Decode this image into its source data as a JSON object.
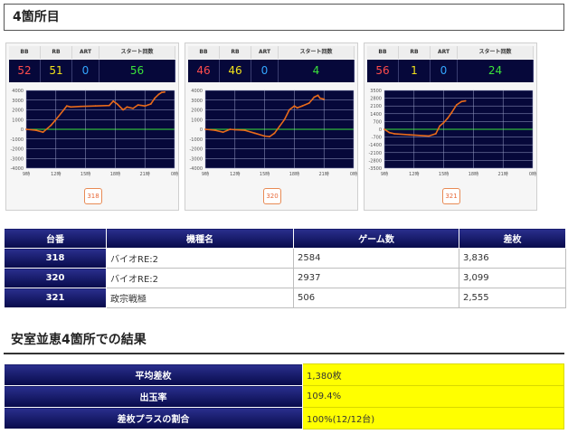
{
  "page_title": "4箇所目",
  "card_headers": [
    "BB",
    "RB",
    "ART",
    "スタート回数"
  ],
  "cards": [
    {
      "bb": "52",
      "rb": "51",
      "art": "0",
      "start": "56",
      "button": "318",
      "y_ticks": [
        "4000",
        "3000",
        "2000",
        "1000",
        "0",
        "-1000",
        "-2000",
        "-3000",
        "-4000"
      ],
      "y_range": [
        -4000,
        4000
      ],
      "x_ticks": [
        "9時",
        "12時",
        "15時",
        "18時",
        "21時",
        "0時"
      ],
      "x_range": [
        9,
        24
      ],
      "series": [
        [
          9,
          0
        ],
        [
          10,
          -100
        ],
        [
          10.7,
          -300
        ],
        [
          11.5,
          400
        ],
        [
          12,
          1000
        ],
        [
          12.8,
          2000
        ],
        [
          13.1,
          2400
        ],
        [
          13.5,
          2300
        ],
        [
          14.5,
          2350
        ],
        [
          16,
          2400
        ],
        [
          17.4,
          2450
        ],
        [
          17.8,
          2900
        ],
        [
          18.2,
          2600
        ],
        [
          18.8,
          2000
        ],
        [
          19.2,
          2300
        ],
        [
          19.8,
          2150
        ],
        [
          20.3,
          2500
        ],
        [
          21,
          2400
        ],
        [
          21.6,
          2600
        ],
        [
          22,
          3200
        ],
        [
          22.4,
          3600
        ],
        [
          22.7,
          3800
        ],
        [
          23,
          3836
        ]
      ]
    },
    {
      "bb": "46",
      "rb": "46",
      "art": "0",
      "start": "4",
      "button": "320",
      "y_ticks": [
        "4000",
        "3000",
        "2000",
        "1000",
        "0",
        "-1000",
        "-2000",
        "-3000",
        "-4000"
      ],
      "y_range": [
        -4000,
        4000
      ],
      "x_ticks": [
        "9時",
        "12時",
        "15時",
        "18時",
        "21時",
        "0時"
      ],
      "x_range": [
        9,
        24
      ],
      "series": [
        [
          9,
          0
        ],
        [
          10,
          -100
        ],
        [
          10.8,
          -300
        ],
        [
          11.5,
          0
        ],
        [
          12,
          -50
        ],
        [
          13,
          -100
        ],
        [
          14,
          -400
        ],
        [
          15,
          -700
        ],
        [
          15.5,
          -750
        ],
        [
          16,
          -400
        ],
        [
          16.5,
          300
        ],
        [
          17,
          1000
        ],
        [
          17.5,
          2000
        ],
        [
          18,
          2400
        ],
        [
          18.3,
          2200
        ],
        [
          18.8,
          2400
        ],
        [
          19.5,
          2700
        ],
        [
          20,
          3300
        ],
        [
          20.4,
          3500
        ],
        [
          20.6,
          3200
        ],
        [
          21,
          3099
        ]
      ]
    },
    {
      "bb": "56",
      "rb": "1",
      "art": "0",
      "start": "24",
      "button": "321",
      "y_ticks": [
        "3500",
        "2800",
        "2100",
        "1400",
        "700",
        "0",
        "-700",
        "-1400",
        "-2100",
        "-2800",
        "-3500"
      ],
      "y_range": [
        -3500,
        3500
      ],
      "x_ticks": [
        "9時",
        "12時",
        "15時",
        "18時",
        "21時",
        "0時"
      ],
      "x_range": [
        9,
        24
      ],
      "series": [
        [
          9,
          0
        ],
        [
          9.5,
          -300
        ],
        [
          10,
          -400
        ],
        [
          11.5,
          -500
        ],
        [
          13.5,
          -600
        ],
        [
          14.2,
          -400
        ],
        [
          14.6,
          300
        ],
        [
          15,
          600
        ],
        [
          15.4,
          1000
        ],
        [
          15.8,
          1500
        ],
        [
          16.3,
          2200
        ],
        [
          16.8,
          2500
        ],
        [
          17.2,
          2555
        ]
      ]
    }
  ],
  "machine_table": {
    "headers": [
      "台番",
      "機種名",
      "ゲーム数",
      "差枚"
    ],
    "rows": [
      [
        "318",
        "バイオRE:2",
        "2584",
        "3,836"
      ],
      [
        "320",
        "バイオRE:2",
        "2937",
        "3,099"
      ],
      [
        "321",
        "政宗戦極",
        "506",
        "2,555"
      ]
    ]
  },
  "result_title": "安室並恵4箇所での結果",
  "summary": [
    {
      "label": "平均差枚",
      "value": "1,380枚"
    },
    {
      "label": "出玉率",
      "value": "109.4%"
    },
    {
      "label": "差枚プラスの割合",
      "value": "100%(12/12台)"
    }
  ],
  "colors": {
    "navy": "#06083a",
    "line": "#e86a1a",
    "zero_line": "#3be23b",
    "highlight": "#ffff00"
  }
}
